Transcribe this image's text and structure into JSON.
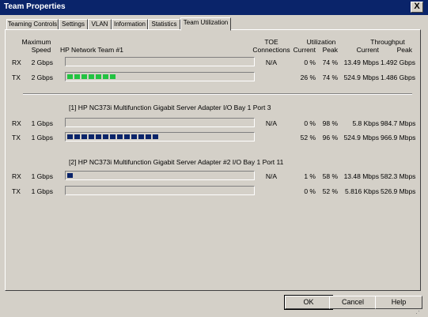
{
  "title": "Team Properties",
  "close_label": "X",
  "tabs": [
    {
      "label": "Teaming Controls"
    },
    {
      "label": "Settings"
    },
    {
      "label": "VLAN"
    },
    {
      "label": "Information"
    },
    {
      "label": "Statistics"
    },
    {
      "label": "Team Utilization"
    }
  ],
  "headers": {
    "max_speed_line1": "Maximum",
    "max_speed_line2": "Speed",
    "toe_line1": "TOE",
    "toe_line2": "Connections",
    "utilization": "Utilization",
    "throughput": "Throughput",
    "current": "Current",
    "peak": "Peak",
    "tp_current": "Current",
    "tp_peak": "Peak"
  },
  "groups": [
    {
      "name": "HP Network Team #1",
      "toe": "N/A",
      "bar_color": "#22c341",
      "segmented": true,
      "rows": [
        {
          "dir": "RX",
          "speed": "2 Gbps",
          "util_current": "0 %",
          "util_peak": "74 %",
          "tp_current": "13.49 Mbps",
          "tp_peak": "1.492 Gbps",
          "level": 0.0
        },
        {
          "dir": "TX",
          "speed": "2 Gbps",
          "util_current": "26 %",
          "util_peak": "74 %",
          "tp_current": "524.9 Mbps",
          "tp_peak": "1.486 Gbps",
          "level": 0.26
        }
      ]
    },
    {
      "name": "[1] HP NC373i Multifunction Gigabit Server Adapter I/O Bay 1 Port 3",
      "toe": "N/A",
      "bar_color": "#0a246a",
      "segmented": true,
      "rows": [
        {
          "dir": "RX",
          "speed": "1 Gbps",
          "util_current": "0 %",
          "util_peak": "98 %",
          "tp_current": "5.8 Kbps",
          "tp_peak": "984.7 Mbps",
          "level": 0.0
        },
        {
          "dir": "TX",
          "speed": "1 Gbps",
          "util_current": "52 %",
          "util_peak": "96 %",
          "tp_current": "524.9 Mbps",
          "tp_peak": "966.9 Mbps",
          "level": 0.52
        }
      ]
    },
    {
      "name": "[2] HP NC373i Multifunction Gigabit Server Adapter #2 I/O Bay 1 Port 11",
      "toe": "N/A",
      "bar_color": "#0a246a",
      "segmented": true,
      "rows": [
        {
          "dir": "RX",
          "speed": "1 Gbps",
          "util_current": "1 %",
          "util_peak": "58 %",
          "tp_current": "13.48 Mbps",
          "tp_peak": "582.3 Mbps",
          "level": 0.01
        },
        {
          "dir": "TX",
          "speed": "1 Gbps",
          "util_current": "0 %",
          "util_peak": "52 %",
          "tp_current": "5.816 Kbps",
          "tp_peak": "526.9 Mbps",
          "level": 0.0
        }
      ]
    }
  ],
  "buttons": {
    "ok": "OK",
    "cancel": "Cancel",
    "help": "Help"
  }
}
